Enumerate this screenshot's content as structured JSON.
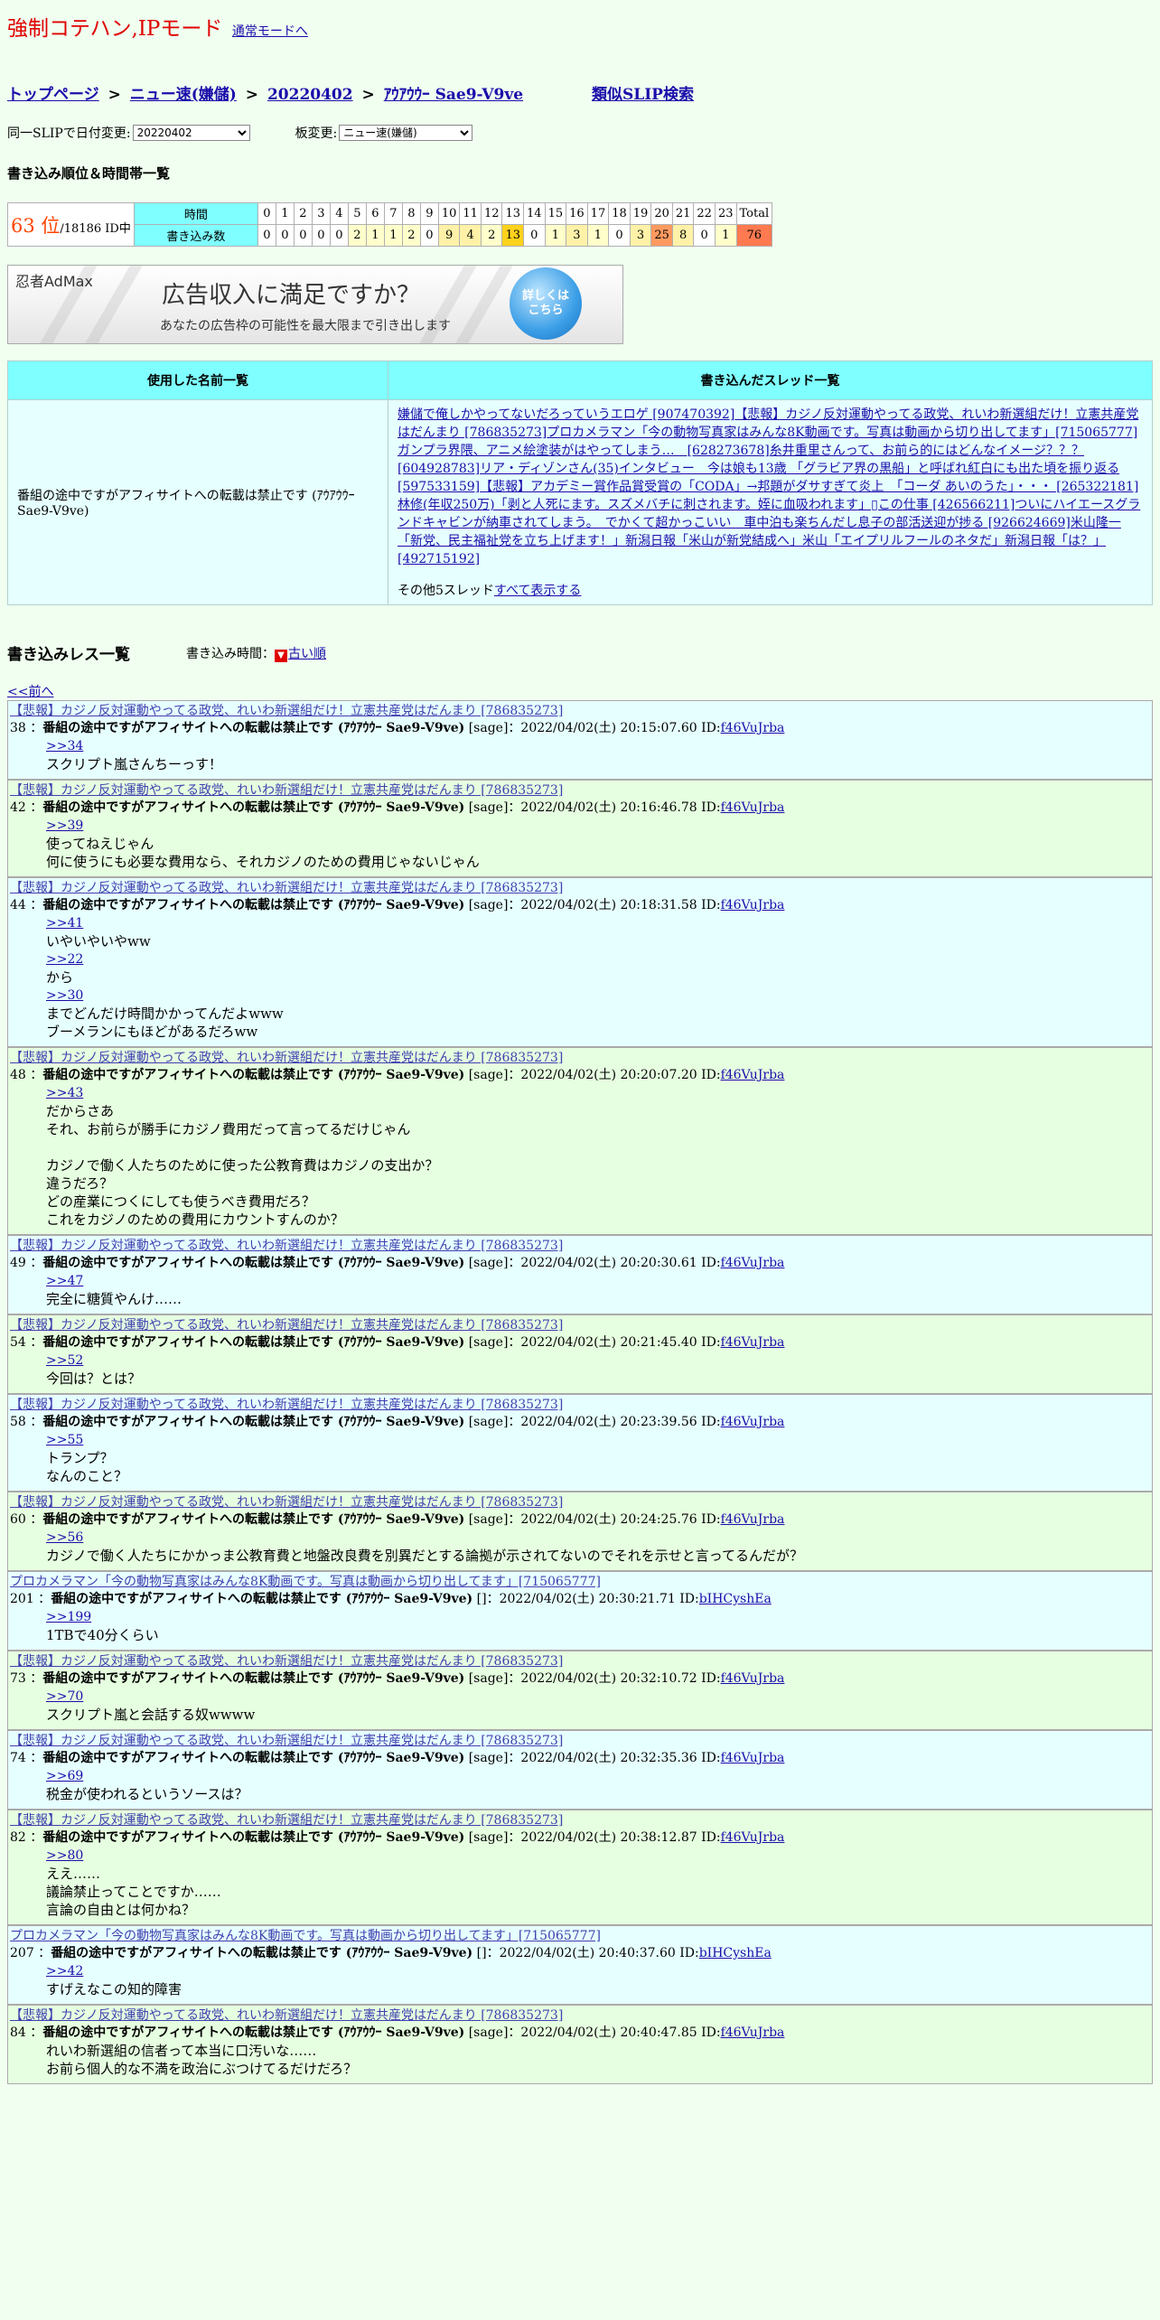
{
  "header": {
    "title": "強制コテハン,IPモード",
    "normal_mode_link": "通常モードへ"
  },
  "breadcrumb": {
    "top": "トップページ",
    "board": "ニュー速(嫌儲)",
    "date": "20220402",
    "slip": "ｱｳｱｳｳｰ Sae9-V9ve",
    "sep": ">",
    "similar": "類似SLIP検索"
  },
  "controls": {
    "date_change_label": "同一SLIPで日付変更:",
    "date_value": "20220402",
    "board_change_label": "板変更:",
    "board_value": "ニュー速(嫌儲)"
  },
  "ranking": {
    "heading": "書き込み順位＆時間帯一覧",
    "rank": "63 位",
    "total_ids": "/18186 ID中",
    "hour_label": "時間",
    "count_label": "書き込み数",
    "hours": [
      "0",
      "1",
      "2",
      "3",
      "4",
      "5",
      "6",
      "7",
      "8",
      "9",
      "10",
      "11",
      "12",
      "13",
      "14",
      "15",
      "16",
      "17",
      "18",
      "19",
      "20",
      "21",
      "22",
      "23",
      "Total"
    ],
    "counts": [
      "0",
      "0",
      "0",
      "0",
      "0",
      "2",
      "1",
      "1",
      "2",
      "0",
      "9",
      "4",
      "2",
      "13",
      "0",
      "1",
      "3",
      "1",
      "0",
      "3",
      "25",
      "8",
      "0",
      "1",
      "76"
    ],
    "levels": [
      0,
      0,
      0,
      0,
      0,
      1,
      1,
      1,
      1,
      0,
      2,
      2,
      1,
      4,
      0,
      1,
      2,
      1,
      0,
      2,
      5,
      2,
      0,
      1,
      6
    ]
  },
  "ad": {
    "brand": "忍者AdMax",
    "headline": "広告収入に満足ですか？",
    "sub": "あなたの広告枠の可能性を最大限まで引き出します",
    "cta": "詳しくはこちら"
  },
  "info": {
    "names_header": "使用した名前一覧",
    "threads_header": "書き込んだスレッド一覧",
    "name_used": "番組の途中ですがアフィサイトへの転載は禁止です (ｱｳｱｳｳｰ Sae9-V9ve)",
    "threads": [
      "嫌儲で俺しかやってないだろっていうエロゲ [907470392]",
      "【悲報】カジノ反対運動やってる政党、れいわ新選組だけ！立憲共産党はだんまり [786835273]",
      "プロカメラマン「今の動物写真家はみんな8K動画です。写真は動画から切り出してます」[715065777]",
      "ガンプラ界隈、アニメ絵塗装がはやってしまう…　[628273678]",
      "糸井重里さんって、お前ら的にはどんなイメージ？？？ [604928783]",
      "リア・ディゾンさん(35)インタビュー　今は娘も13歳 「グラビア界の黒船」と呼ばれ紅白にも出た頃を振り返る [597533159]",
      "【悲報】アカデミー賞作品賞受賞の「CODA」→邦題がダサすぎて炎上　「コーダ あいのうた」・・・ [265322181]",
      "林修(年収250万)「剥と人死にます。スズメバチに刺されます。姪に血吸われます」▯この仕事 [426566211]",
      "ついにハイエースグランドキャビンが納車されてしまう。　でかくて超かっこいい　車中泊も楽ちんだし息子の部活送迎が捗る [926624669]",
      "米山隆一「新党、民主福祉党を立ち上げます！」新潟日報「米山が新党結成へ」米山「エイプリルフールのネタだ」新潟日報「は？」[492715192]"
    ],
    "more_text": "その他5スレッド",
    "more_link": "すべて表示する"
  },
  "posts_section": {
    "heading": "書き込みレス一覧",
    "time_label": "書き込み時間：",
    "old_order_icon": "▼",
    "old_order_link": "古い順",
    "prev_link": "<<前へ"
  },
  "posts": [
    {
      "thread": "【悲報】カジノ反対運動やってる政党、れいわ新選組だけ！立憲共産党はだんまり [786835273]",
      "num": "38",
      "name": "番組の途中ですがアフィサイトへの転載は禁止です (ｱｳｱｳｳｰ Sae9-V9ve)",
      "mail": "[sage]",
      "date": "2022/04/02(土) 20:15:07.60 ID:",
      "id": "f46VuJrba",
      "lines": [
        ">>34",
        "スクリプト嵐さんちーっす！"
      ],
      "bg": "b"
    },
    {
      "thread": "【悲報】カジノ反対運動やってる政党、れいわ新選組だけ！立憲共産党はだんまり [786835273]",
      "num": "42",
      "name": "番組の途中ですがアフィサイトへの転載は禁止です (ｱｳｱｳｳｰ Sae9-V9ve)",
      "mail": "[sage]",
      "date": "2022/04/02(土) 20:16:46.78 ID:",
      "id": "f46VuJrba",
      "lines": [
        ">>39",
        "使ってねえじゃん",
        "何に使うにも必要な費用なら、それカジノのための費用じゃないじゃん"
      ],
      "bg": "g"
    },
    {
      "thread": "【悲報】カジノ反対運動やってる政党、れいわ新選組だけ！立憲共産党はだんまり [786835273]",
      "num": "44",
      "name": "番組の途中ですがアフィサイトへの転載は禁止です (ｱｳｱｳｳｰ Sae9-V9ve)",
      "mail": "[sage]",
      "date": "2022/04/02(土) 20:18:31.58 ID:",
      "id": "f46VuJrba",
      "lines": [
        ">>41",
        "いやいやいやww",
        ">>22",
        "から",
        ">>30",
        "までどんだけ時間かかってんだよwww",
        "ブーメランにもほどがあるだろww"
      ],
      "bg": "b"
    },
    {
      "thread": "【悲報】カジノ反対運動やってる政党、れいわ新選組だけ！立憲共産党はだんまり [786835273]",
      "num": "48",
      "name": "番組の途中ですがアフィサイトへの転載は禁止です (ｱｳｱｳｳｰ Sae9-V9ve)",
      "mail": "[sage]",
      "date": "2022/04/02(土) 20:20:07.20 ID:",
      "id": "f46VuJrba",
      "lines": [
        ">>43",
        "だからさあ",
        "それ、お前らが勝手にカジノ費用だって言ってるだけじゃん",
        "",
        "カジノで働く人たちのために使った公教育費はカジノの支出か？",
        "違うだろ？",
        "どの産業につくにしても使うべき費用だろ？",
        "これをカジノのための費用にカウントすんのか？"
      ],
      "bg": "g"
    },
    {
      "thread": "【悲報】カジノ反対運動やってる政党、れいわ新選組だけ！立憲共産党はだんまり [786835273]",
      "num": "49",
      "name": "番組の途中ですがアフィサイトへの転載は禁止です (ｱｳｱｳｳｰ Sae9-V9ve)",
      "mail": "[sage]",
      "date": "2022/04/02(土) 20:20:30.61 ID:",
      "id": "f46VuJrba",
      "lines": [
        ">>47",
        "完全に糖質やんけ……"
      ],
      "bg": "b"
    },
    {
      "thread": "【悲報】カジノ反対運動やってる政党、れいわ新選組だけ！立憲共産党はだんまり [786835273]",
      "num": "54",
      "name": "番組の途中ですがアフィサイトへの転載は禁止です (ｱｳｱｳｳｰ Sae9-V9ve)",
      "mail": "[sage]",
      "date": "2022/04/02(土) 20:21:45.40 ID:",
      "id": "f46VuJrba",
      "lines": [
        ">>52",
        "今回は？とは？"
      ],
      "bg": "g"
    },
    {
      "thread": "【悲報】カジノ反対運動やってる政党、れいわ新選組だけ！立憲共産党はだんまり [786835273]",
      "num": "58",
      "name": "番組の途中ですがアフィサイトへの転載は禁止です (ｱｳｱｳｳｰ Sae9-V9ve)",
      "mail": "[sage]",
      "date": "2022/04/02(土) 20:23:39.56 ID:",
      "id": "f46VuJrba",
      "lines": [
        ">>55",
        "トランプ？",
        "なんのこと？"
      ],
      "bg": "b"
    },
    {
      "thread": "【悲報】カジノ反対運動やってる政党、れいわ新選組だけ！立憲共産党はだんまり [786835273]",
      "num": "60",
      "name": "番組の途中ですがアフィサイトへの転載は禁止です (ｱｳｱｳｳｰ Sae9-V9ve)",
      "mail": "[sage]",
      "date": "2022/04/02(土) 20:24:25.76 ID:",
      "id": "f46VuJrba",
      "lines": [
        ">>56",
        "カジノで働く人たちにかかっま公教育費と地盤改良費を別異だとする論拠が示されてないのでそれを示せと言ってるんだが？"
      ],
      "bg": "g"
    },
    {
      "thread": "プロカメラマン「今の動物写真家はみんな8K動画です。写真は動画から切り出してます」[715065777]",
      "num": "201",
      "name": "番組の途中ですがアフィサイトへの転載は禁止です (ｱｳｱｳｳｰ Sae9-V9ve)",
      "mail": "[]",
      "date": "2022/04/02(土) 20:30:21.71 ID:",
      "id": "bIHCyshEa",
      "lines": [
        ">>199",
        "1TBで40分くらい"
      ],
      "bg": "b"
    },
    {
      "thread": "【悲報】カジノ反対運動やってる政党、れいわ新選組だけ！立憲共産党はだんまり [786835273]",
      "num": "73",
      "name": "番組の途中ですがアフィサイトへの転載は禁止です (ｱｳｱｳｳｰ Sae9-V9ve)",
      "mail": "[sage]",
      "date": "2022/04/02(土) 20:32:10.72 ID:",
      "id": "f46VuJrba",
      "lines": [
        ">>70",
        "スクリプト嵐と会話する奴wwww"
      ],
      "bg": "g"
    },
    {
      "thread": "【悲報】カジノ反対運動やってる政党、れいわ新選組だけ！立憲共産党はだんまり [786835273]",
      "num": "74",
      "name": "番組の途中ですがアフィサイトへの転載は禁止です (ｱｳｱｳｳｰ Sae9-V9ve)",
      "mail": "[sage]",
      "date": "2022/04/02(土) 20:32:35.36 ID:",
      "id": "f46VuJrba",
      "lines": [
        ">>69",
        "税金が使われるというソースは？"
      ],
      "bg": "b"
    },
    {
      "thread": "【悲報】カジノ反対運動やってる政党、れいわ新選組だけ！立憲共産党はだんまり [786835273]",
      "num": "82",
      "name": "番組の途中ですがアフィサイトへの転載は禁止です (ｱｳｱｳｳｰ Sae9-V9ve)",
      "mail": "[sage]",
      "date": "2022/04/02(土) 20:38:12.87 ID:",
      "id": "f46VuJrba",
      "lines": [
        ">>80",
        "ええ……",
        "議論禁止ってことですか……",
        "言論の自由とは何かね？"
      ],
      "bg": "g"
    },
    {
      "thread": "プロカメラマン「今の動物写真家はみんな8K動画です。写真は動画から切り出してます」[715065777]",
      "num": "207",
      "name": "番組の途中ですがアフィサイトへの転載は禁止です (ｱｳｱｳｳｰ Sae9-V9ve)",
      "mail": "[]",
      "date": "2022/04/02(土) 20:40:37.60 ID:",
      "id": "bIHCyshEa",
      "lines": [
        ">>42",
        "すげえなこの知的障害"
      ],
      "bg": "b"
    },
    {
      "thread": "【悲報】カジノ反対運動やってる政党、れいわ新選組だけ！立憲共産党はだんまり [786835273]",
      "num": "84",
      "name": "番組の途中ですがアフィサイトへの転載は禁止です (ｱｳｱｳｳｰ Sae9-V9ve)",
      "mail": "[sage]",
      "date": "2022/04/02(土) 20:40:47.85 ID:",
      "id": "f46VuJrba",
      "lines": [
        "れいわ新選組の信者って本当に口汚いな……",
        "お前ら個人的な不満を政治にぶつけてるだけだろ？"
      ],
      "bg": "g"
    }
  ]
}
